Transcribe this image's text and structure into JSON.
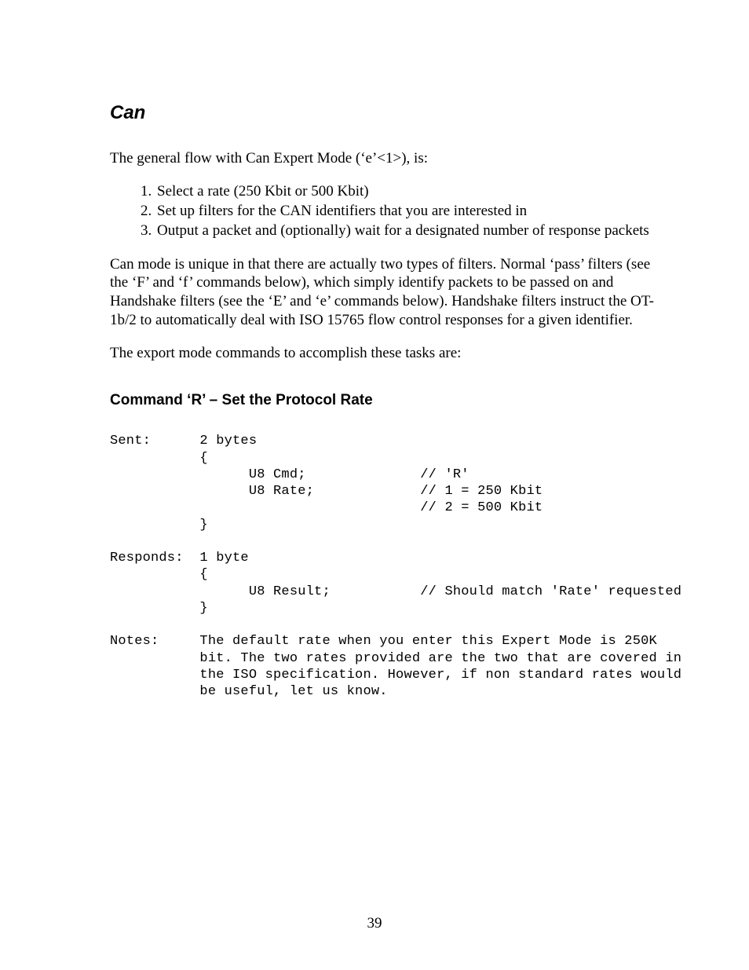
{
  "heading": "Can",
  "intro": "The general flow with Can Expert Mode (‘e’<1>), is:",
  "steps": [
    "Select a rate (250 Kbit or 500 Kbit)",
    "Set up filters for the CAN identifiers that you are interested in",
    "Output a packet and (optionally) wait for a designated number of response packets"
  ],
  "para2": "Can mode is unique in that there are actually two types of filters. Normal ‘pass’ filters (see the ‘F’ and ‘f’ commands below), which simply identify packets to be passed on and Handshake filters (see the ‘E’ and ‘e’ commands below). Handshake filters instruct the OT-1b/2 to automatically deal with ISO 15765 flow control responses for a given identifier.",
  "para3": "The export mode commands to accomplish these tasks are:",
  "subheading": "Command ‘R’ – Set the Protocol Rate",
  "code_block": "Sent:      2 bytes\n           {\n                 U8 Cmd;              // 'R'\n                 U8 Rate;             // 1 = 250 Kbit\n                                      // 2 = 500 Kbit\n           }\n\nResponds:  1 byte\n           {\n                 U8 Result;           // Should match 'Rate' requested\n           }\n\nNotes:     The default rate when you enter this Expert Mode is 250K\n           bit. The two rates provided are the two that are covered in\n           the ISO specification. However, if non standard rates would\n           be useful, let us know.",
  "page_number": "39"
}
